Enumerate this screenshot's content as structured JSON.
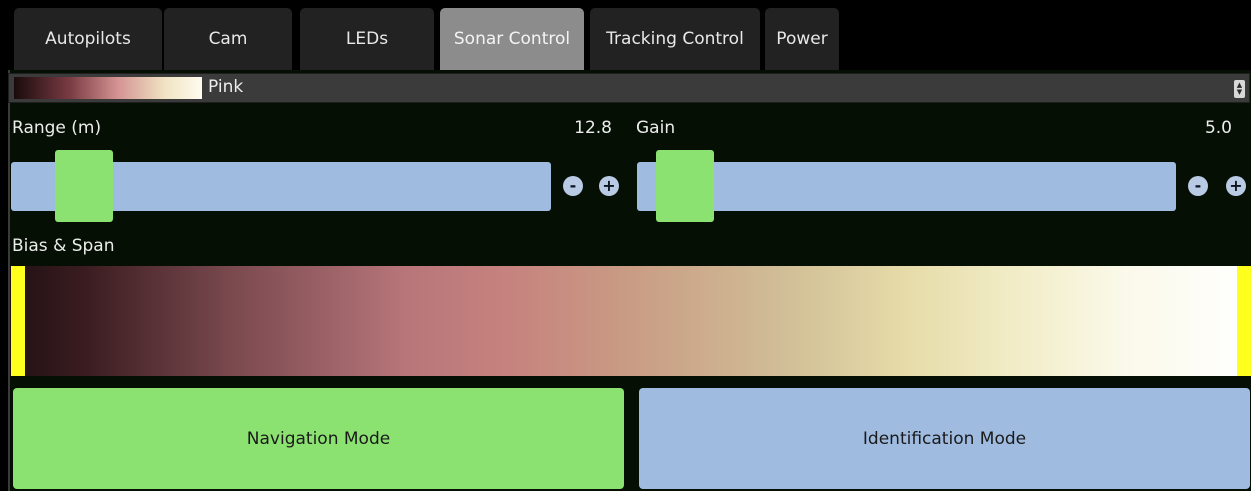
{
  "tabs": [
    {
      "label": "Autopilots",
      "active": false
    },
    {
      "label": "Cam",
      "active": false
    },
    {
      "label": "LEDs",
      "active": false
    },
    {
      "label": "Sonar Control",
      "active": true
    },
    {
      "label": "Tracking Control",
      "active": false
    },
    {
      "label": "Power",
      "active": false
    }
  ],
  "palette": {
    "selected": "Pink",
    "colors": [
      "#1a0a0c",
      "#7a3c44",
      "#d49292",
      "#efe3c2",
      "#fffbef"
    ]
  },
  "range": {
    "label": "Range (m)",
    "value": "12.8"
  },
  "gain": {
    "label": "Gain",
    "value": "5.0"
  },
  "buttons": {
    "minus": "-",
    "plus": "+"
  },
  "bias_span": {
    "label": "Bias & Span"
  },
  "modes": {
    "navigation": "Navigation Mode",
    "identification": "Identification Mode"
  },
  "colors": {
    "slider_track": "#9fbbe0",
    "slider_handle": "#8be271",
    "span_marker": "#ffff1e",
    "active_tab": "#8c8c8c"
  }
}
